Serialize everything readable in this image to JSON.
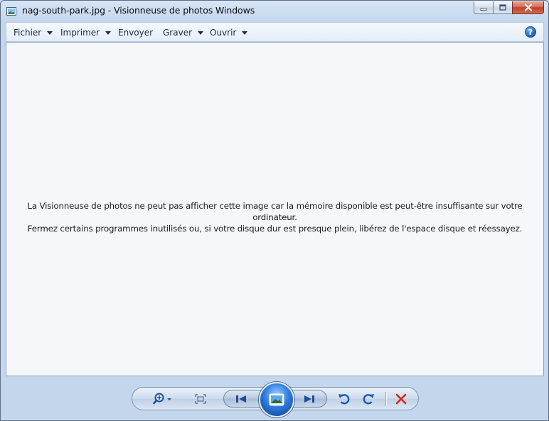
{
  "window": {
    "title": "nag-south-park.jpg - Visionneuse de photos Windows",
    "caption_buttons": [
      "minimize",
      "maximize",
      "close"
    ]
  },
  "menubar": {
    "items": [
      {
        "label": "Fichier",
        "has_dropdown": true
      },
      {
        "label": "Imprimer",
        "has_dropdown": true
      },
      {
        "label": "Envoyer",
        "has_dropdown": false
      },
      {
        "label": "Graver",
        "has_dropdown": true
      },
      {
        "label": "Ouvrir",
        "has_dropdown": true
      }
    ],
    "help": "?"
  },
  "content": {
    "error_line1": "La Visionneuse de photos ne peut pas afficher cette image car la mémoire disponible est peut-être insuffisante sur votre ordinateur.",
    "error_line2": "Fermez certains programmes inutilisés ou, si votre disque dur est presque plein, libérez de l'espace disque et réessayez."
  },
  "controls": {
    "icons": [
      "zoom-icon",
      "fit-to-window-icon",
      "previous-icon",
      "slideshow-icon",
      "next-icon",
      "rotate-left-icon",
      "rotate-right-icon",
      "delete-icon"
    ]
  },
  "colors": {
    "accent_blue": "#1f5fb5",
    "delete_red": "#d7261e"
  }
}
